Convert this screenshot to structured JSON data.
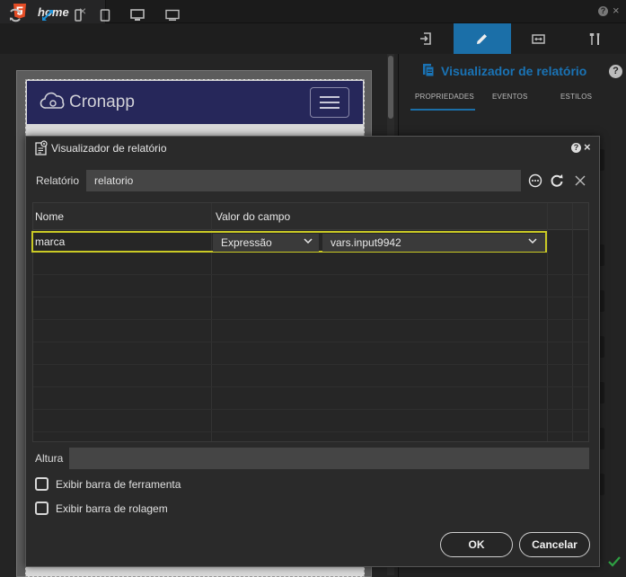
{
  "tab": {
    "title": "home",
    "close": "×"
  },
  "topbar": {
    "help": "?",
    "close": "×"
  },
  "canvas": {
    "brand": "Cronapp"
  },
  "right_panel": {
    "title": "Visualizador de relatório",
    "help": "?",
    "subtabs": [
      "PROPRIEDADES",
      "EVENTOS",
      "ESTILOS"
    ]
  },
  "dialog": {
    "title": "Visualizador de relatório",
    "help": "?",
    "close": "×",
    "relatorio_label": "Relatório",
    "relatorio_value": "relatorio",
    "grid": {
      "headers": [
        "Nome",
        "Valor do campo"
      ],
      "rows": [
        {
          "name": "marca",
          "type": "Expressão",
          "value": "vars.input9942"
        }
      ]
    },
    "altura_label": "Altura",
    "altura_value": "",
    "checkbox_toolbar": "Exibir barra de ferramenta",
    "checkbox_scroll": "Exibir barra de rolagem",
    "ok_label": "OK",
    "cancel_label": "Cancelar"
  },
  "colors": {
    "accent": "#1b6fa8",
    "highlight": "#c9c925",
    "navbar": "#26275a"
  }
}
